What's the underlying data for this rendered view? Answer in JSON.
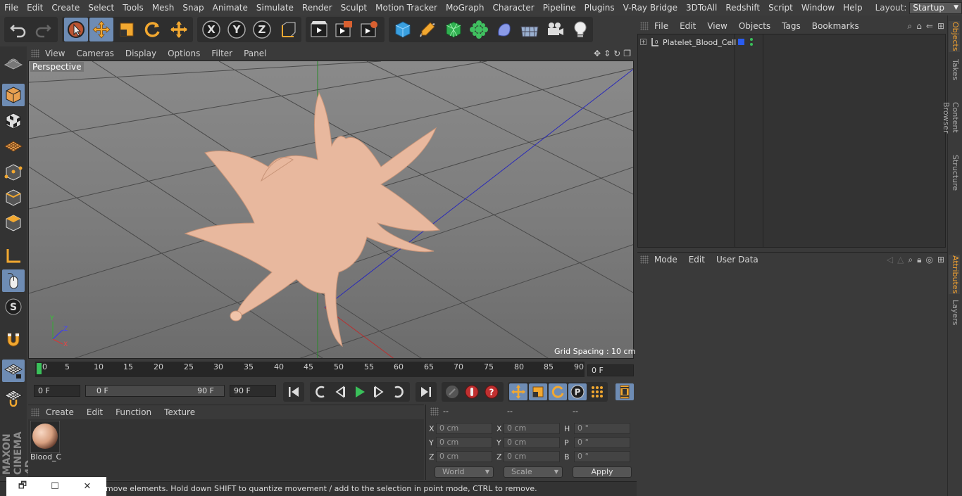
{
  "menubar": {
    "items": [
      "File",
      "Edit",
      "Create",
      "Select",
      "Tools",
      "Mesh",
      "Snap",
      "Animate",
      "Simulate",
      "Render",
      "Sculpt",
      "Motion Tracker",
      "MoGraph",
      "Character",
      "Pipeline",
      "Plugins",
      "V-Ray Bridge",
      "3DToAll",
      "Redshift",
      "Script",
      "Window",
      "Help"
    ],
    "layout_label": "Layout:",
    "layout_value": "Startup"
  },
  "toolbar": {
    "buttons": [
      {
        "name": "undo-icon"
      },
      {
        "name": "redo-icon"
      },
      {
        "name": "live-selection-icon",
        "selected": true
      },
      {
        "name": "move-icon",
        "selected": true
      },
      {
        "name": "scale-icon"
      },
      {
        "name": "rotate-icon"
      },
      {
        "name": "recent-tool-icon"
      },
      {
        "name": "x-axis-icon",
        "label": "X"
      },
      {
        "name": "y-axis-icon",
        "label": "Y"
      },
      {
        "name": "z-axis-icon",
        "label": "Z"
      },
      {
        "name": "coordinate-system-icon"
      },
      {
        "name": "render-view-icon"
      },
      {
        "name": "render-picture-viewer-icon"
      },
      {
        "name": "edit-render-settings-icon"
      },
      {
        "name": "cube-icon"
      },
      {
        "name": "pen-icon"
      },
      {
        "name": "subdivision-icon"
      },
      {
        "name": "cloner-icon"
      },
      {
        "name": "deformer-icon"
      },
      {
        "name": "floor-icon"
      },
      {
        "name": "camera-icon"
      },
      {
        "name": "light-icon"
      }
    ]
  },
  "viewport": {
    "menu": [
      "View",
      "Cameras",
      "Display",
      "Options",
      "Filter",
      "Panel"
    ],
    "label": "Perspective",
    "grid_spacing": "Grid Spacing : 10 cm",
    "object_color": "#e8b89e"
  },
  "timeline": {
    "ticks": [
      "0",
      "5",
      "10",
      "15",
      "20",
      "25",
      "30",
      "35",
      "40",
      "45",
      "50",
      "55",
      "60",
      "65",
      "70",
      "75",
      "80",
      "85",
      "90"
    ],
    "current_frame": "0 F"
  },
  "playback": {
    "start": "0 F",
    "range_start": "0 F",
    "range_end": "90 F",
    "end": "90 F"
  },
  "material_manager": {
    "menu": [
      "Create",
      "Edit",
      "Function",
      "Texture"
    ],
    "materials": [
      {
        "name": "Blood_C"
      }
    ]
  },
  "coordinates": {
    "headers": [
      "--",
      "--",
      "--"
    ],
    "rows": [
      {
        "a": "X",
        "av": "0 cm",
        "b": "X",
        "bv": "0 cm",
        "c": "H",
        "cv": "0 °"
      },
      {
        "a": "Y",
        "av": "0 cm",
        "b": "Y",
        "bv": "0 cm",
        "c": "P",
        "cv": "0 °"
      },
      {
        "a": "Z",
        "av": "0 cm",
        "b": "Z",
        "bv": "0 cm",
        "c": "B",
        "cv": "0 °"
      }
    ],
    "space": "World",
    "mode": "Scale",
    "apply": "Apply"
  },
  "status": {
    "text": "move elements. Hold down SHIFT to quantize movement / add to the selection in point mode, CTRL to remove."
  },
  "object_manager": {
    "menu": [
      "File",
      "Edit",
      "View",
      "Objects",
      "Tags",
      "Bookmarks"
    ],
    "objects": [
      {
        "name": "Platelet_Blood_Cell"
      }
    ]
  },
  "attributes": {
    "menu": [
      "Mode",
      "Edit",
      "User Data"
    ]
  },
  "sidetabs": {
    "top": [
      "Objects",
      "Takes",
      "Content Browser",
      "Structure"
    ],
    "bottom": [
      "Attributes",
      "Layers"
    ]
  },
  "branding": {
    "logo": "MAXON CINEMA 4D"
  },
  "window_controls": {
    "minimize": "🗗",
    "maximize": "☐",
    "close": "✕"
  }
}
